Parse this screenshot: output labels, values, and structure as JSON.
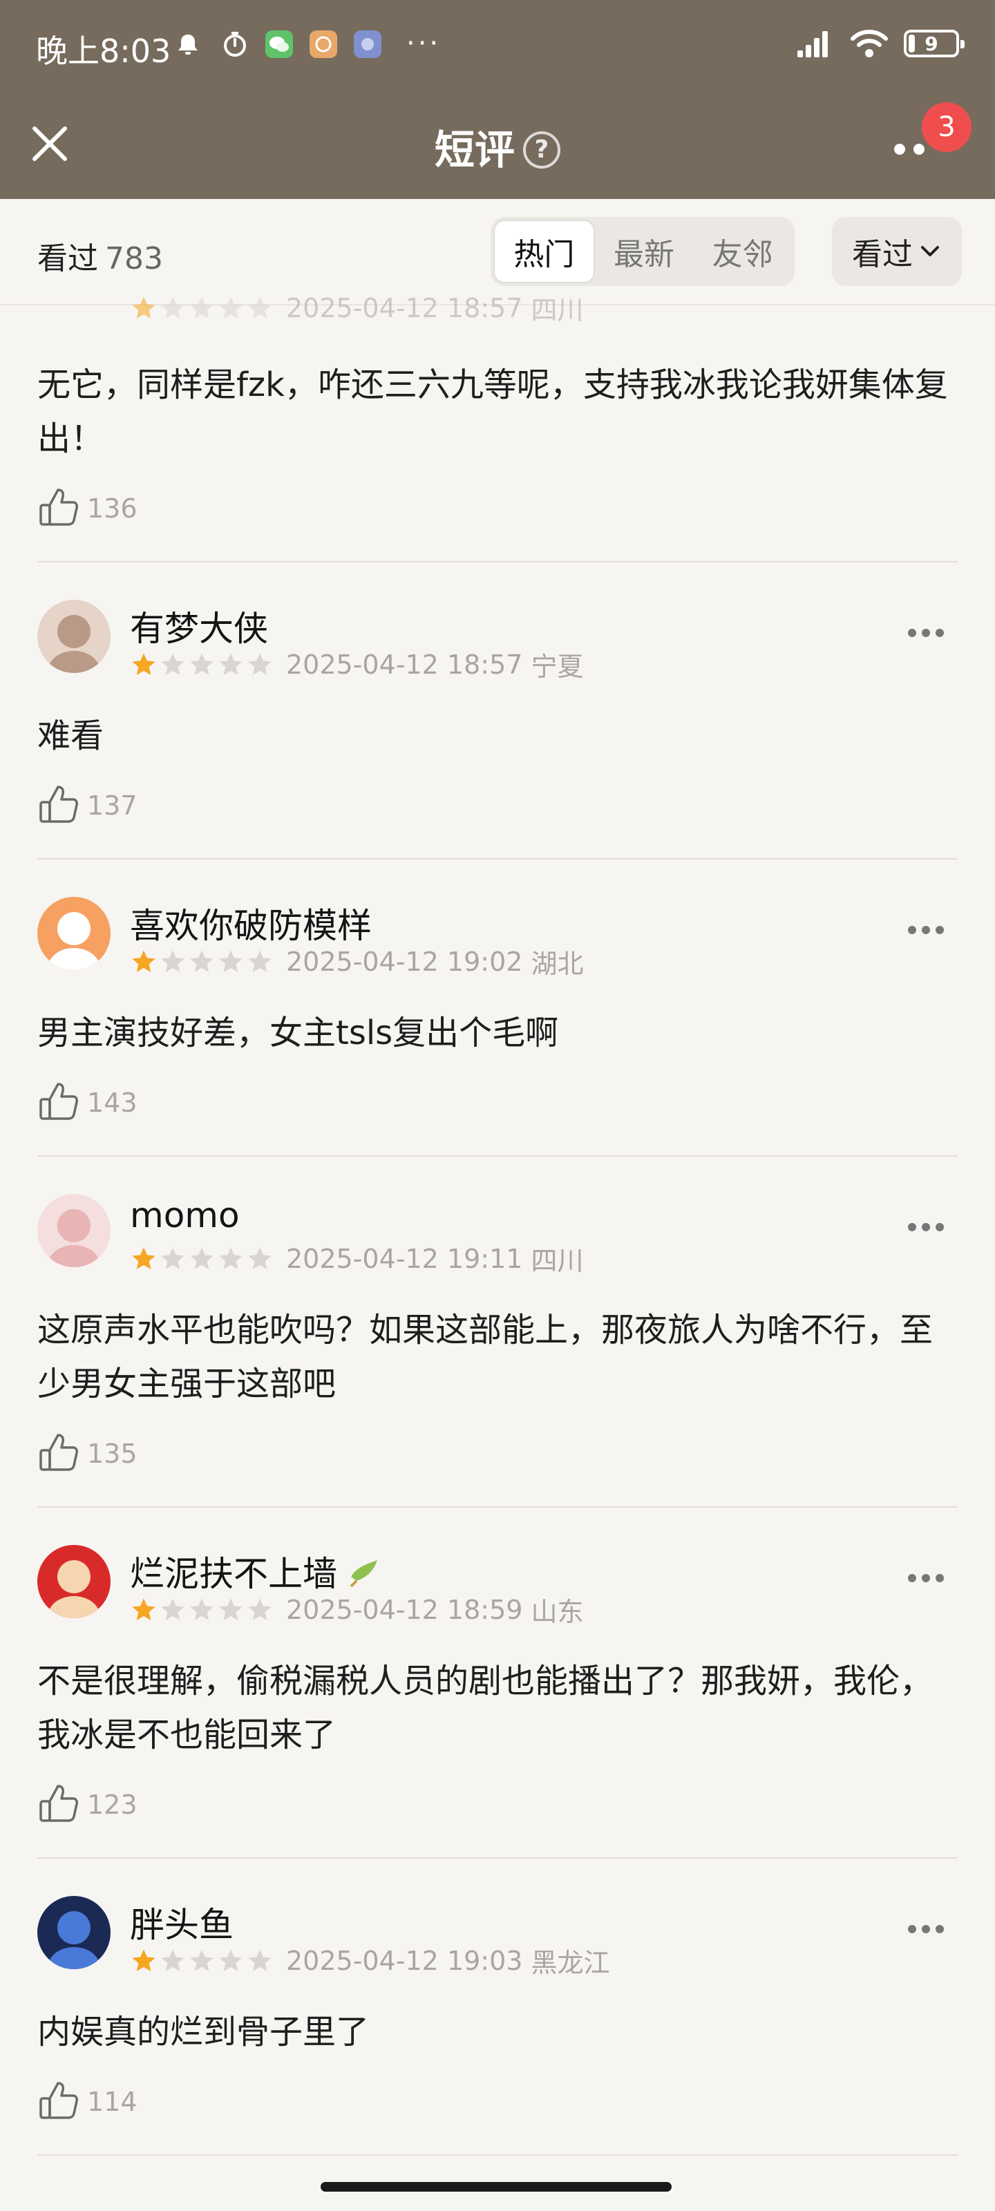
{
  "status_bar": {
    "time": "晚上8:03",
    "battery": "9",
    "dots": "···"
  },
  "nav": {
    "title": "短评",
    "help": "?",
    "badge": "3"
  },
  "filter": {
    "seen_label": "看过",
    "seen_count": "783",
    "tabs": [
      "热门",
      "最新",
      "友邻"
    ],
    "dropdown": "看过"
  },
  "comments": [
    {
      "user": "",
      "rating": 1,
      "date": "2025-04-12 18:57",
      "location": "四川",
      "text": "无它，同样是fzk，咋还三六九等呢，支持我冰我论我妍集体复出！",
      "likes": "136"
    },
    {
      "user": "有梦大侠",
      "rating": 1,
      "date": "2025-04-12 18:57",
      "location": "宁夏",
      "text": "难看",
      "likes": "137"
    },
    {
      "user": "喜欢你破防模样",
      "rating": 1,
      "date": "2025-04-12 19:02",
      "location": "湖北",
      "text": "男主演技好差，女主tsls复出个毛啊",
      "likes": "143"
    },
    {
      "user": "momo",
      "rating": 1,
      "date": "2025-04-12 19:11",
      "location": "四川",
      "text": "这原声水平也能吹吗？如果这部能上，那夜旅人为啥不行，至少男女主强于这部吧",
      "likes": "135"
    },
    {
      "user": "烂泥扶不上墙",
      "rating": 1,
      "date": "2025-04-12 18:59",
      "location": "山东",
      "text": "不是很理解，偷税漏税人员的剧也能播出了？那我妍，我伦，我冰是不也能回来了",
      "likes": "123"
    },
    {
      "user": "胖头鱼",
      "rating": 1,
      "date": "2025-04-12 19:03",
      "location": "黑龙江",
      "text": "内娱真的烂到骨子里了",
      "likes": "114"
    }
  ]
}
